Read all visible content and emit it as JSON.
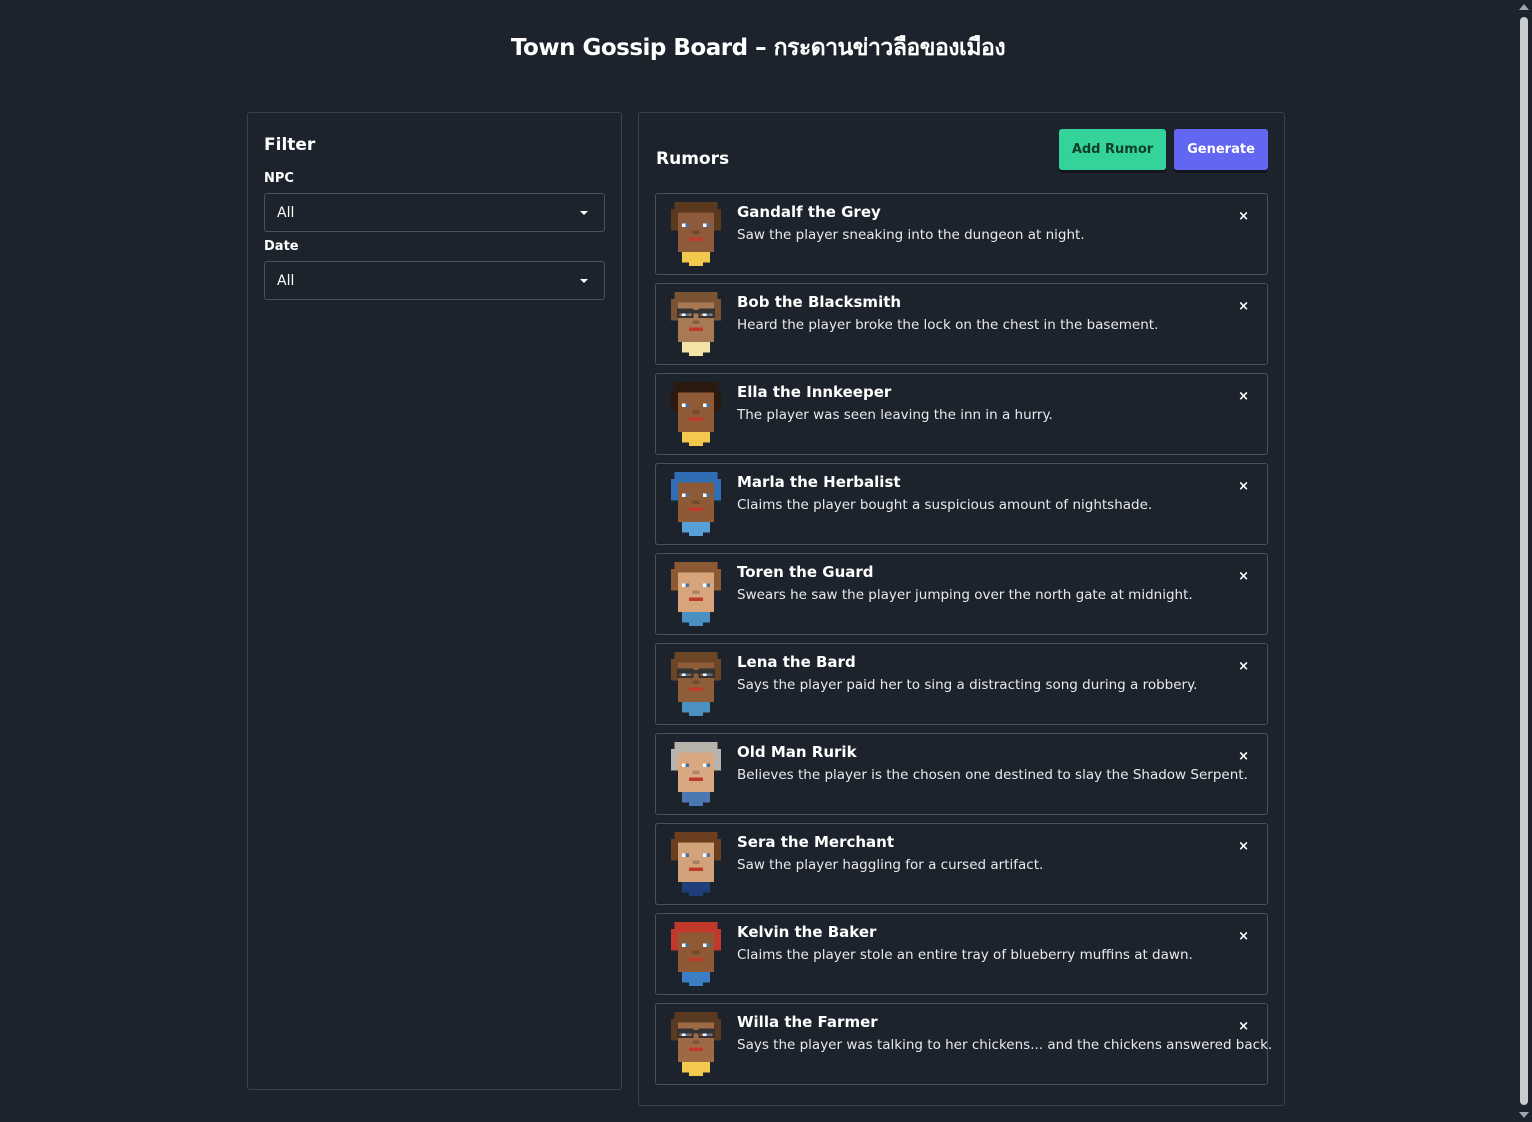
{
  "page": {
    "title": "Town Gossip Board – กระดานข่าวลือของเมือง"
  },
  "filter": {
    "title": "Filter",
    "npc_label": "NPC",
    "npc_value": "All",
    "date_label": "Date",
    "date_value": "All"
  },
  "rumors_panel": {
    "title": "Rumors",
    "add_label": "Add Rumor",
    "generate_label": "Generate",
    "add_color": "#34d399",
    "generate_color": "#6366f1"
  },
  "rumors": [
    {
      "name": "Gandalf the Grey",
      "text": "Saw the player sneaking into the dungeon at night.",
      "delete_label": "×",
      "avatar": {
        "hair": "#5a3a1e",
        "skin": "#8d5a3b",
        "shirt": "#f2c94c",
        "glasses": false
      }
    },
    {
      "name": "Bob the Blacksmith",
      "text": "Heard the player broke the lock on the chest in the basement.",
      "delete_label": "×",
      "avatar": {
        "hair": "#7a5234",
        "skin": "#a77a55",
        "shirt": "#f3e3a4",
        "glasses": true
      }
    },
    {
      "name": "Ella the Innkeeper",
      "text": "The player was seen leaving the inn in a hurry.",
      "delete_label": "×",
      "avatar": {
        "hair": "#2b1a10",
        "skin": "#8f5a36",
        "shirt": "#f2c94c",
        "glasses": false
      }
    },
    {
      "name": "Marla the Herbalist",
      "text": "Claims the player bought a suspicious amount of nightshade.",
      "delete_label": "×",
      "avatar": {
        "hair": "#2f6db5",
        "skin": "#8c5a36",
        "shirt": "#5aa0d8",
        "glasses": false
      }
    },
    {
      "name": "Toren the Guard",
      "text": "Swears he saw the player jumping over the north gate at midnight.",
      "delete_label": "×",
      "avatar": {
        "hair": "#8b5a32",
        "skin": "#d6a57c",
        "shirt": "#4a90c0",
        "glasses": false
      }
    },
    {
      "name": "Lena the Bard",
      "text": "Says the player paid her to sing a distracting song during a robbery.",
      "delete_label": "×",
      "avatar": {
        "hair": "#6b4526",
        "skin": "#8e5d3a",
        "shirt": "#4a90c0",
        "glasses": true
      }
    },
    {
      "name": "Old Man Rurik",
      "text": "Believes the player is the chosen one destined to slay the Shadow Serpent.",
      "delete_label": "×",
      "avatar": {
        "hair": "#b9b4ab",
        "skin": "#d8a882",
        "shirt": "#4a78b0",
        "glasses": false
      }
    },
    {
      "name": "Sera the Merchant",
      "text": "Saw the player haggling for a cursed artifact.",
      "delete_label": "×",
      "avatar": {
        "hair": "#6b3e1e",
        "skin": "#d2a27a",
        "shirt": "#1f3f7a",
        "glasses": false
      }
    },
    {
      "name": "Kelvin the Baker",
      "text": "Claims the player stole an entire tray of blueberry muffins at dawn.",
      "delete_label": "×",
      "avatar": {
        "hair": "#c0392b",
        "skin": "#8e5a36",
        "shirt": "#3a7fc4",
        "glasses": false
      }
    },
    {
      "name": "Willa the Farmer",
      "text": "Says the player was talking to her chickens... and the chickens answered back.",
      "delete_label": "×",
      "avatar": {
        "hair": "#5b3a22",
        "skin": "#9c6a45",
        "shirt": "#f2c94c",
        "glasses": true
      }
    }
  ]
}
